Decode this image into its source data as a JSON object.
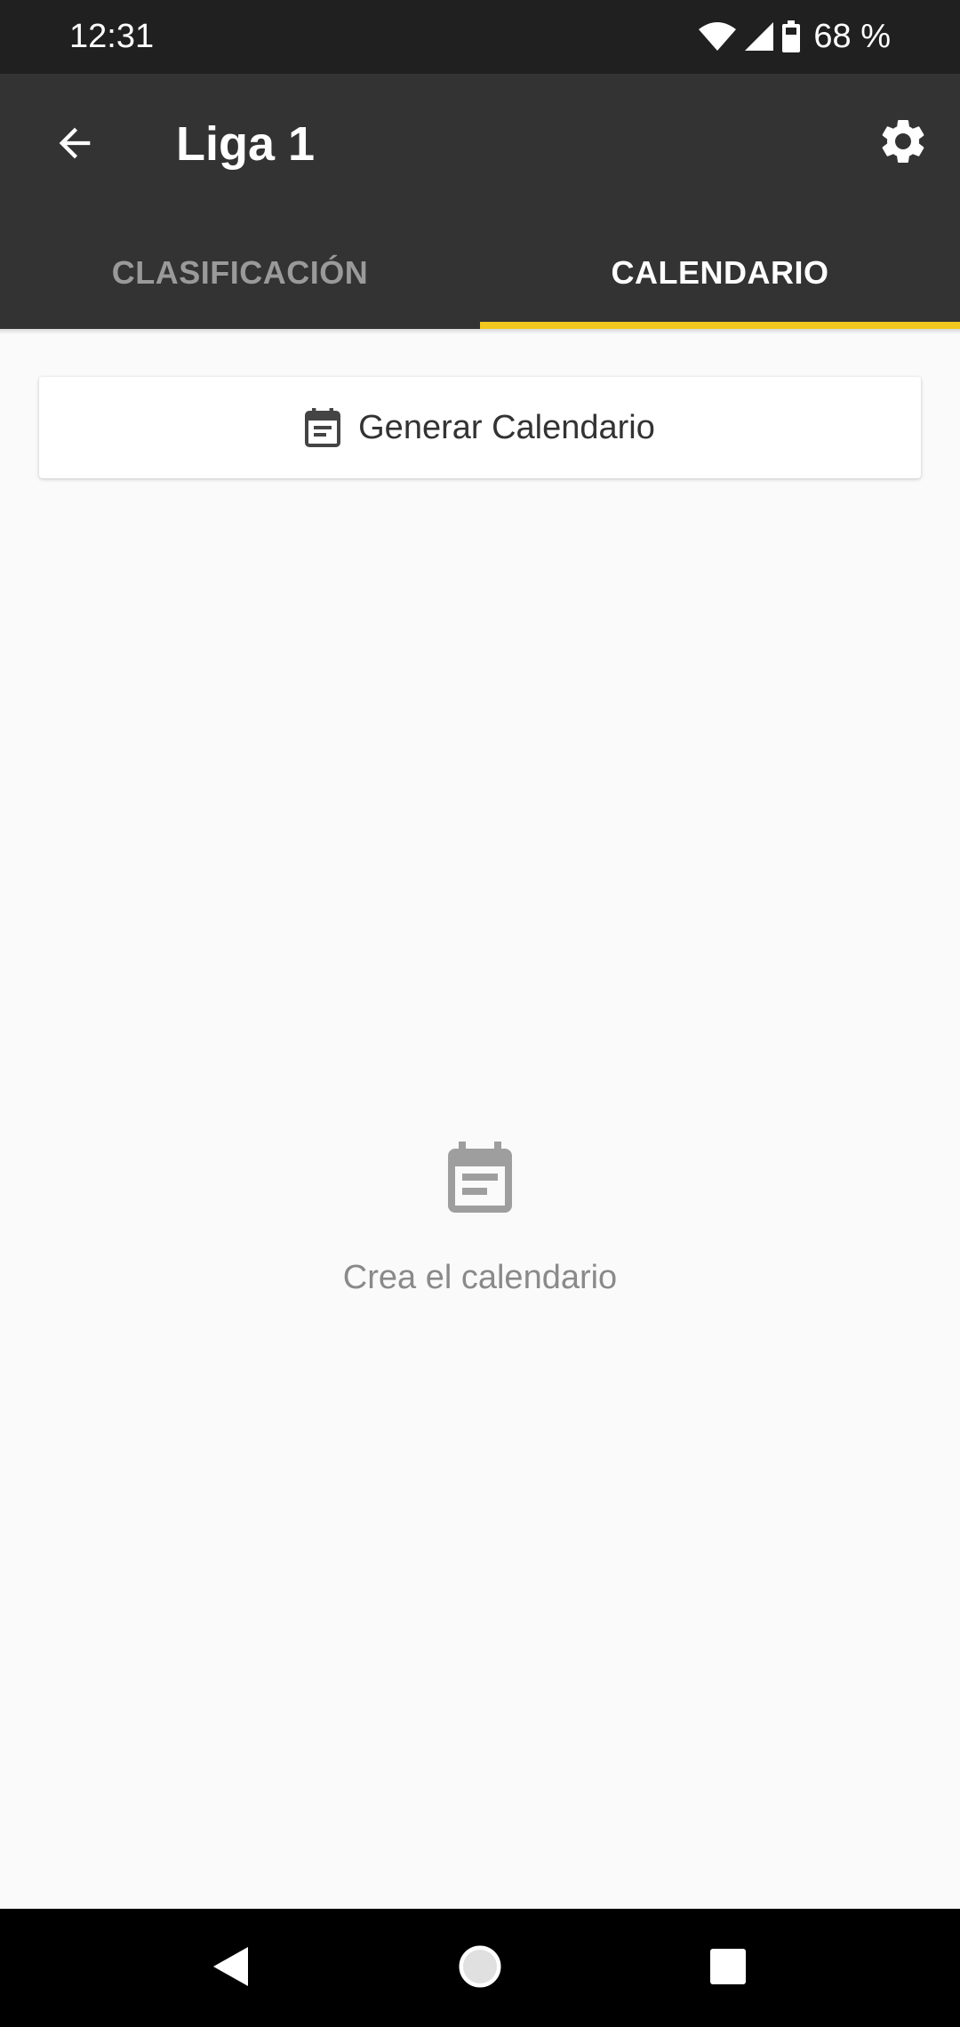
{
  "status_bar": {
    "time": "12:31",
    "battery": "68 %",
    "icons": [
      "wifi-icon",
      "signal-icon",
      "battery-icon"
    ]
  },
  "app_bar": {
    "title": "Liga 1",
    "back_icon": "arrow-back-icon",
    "settings_icon": "gear-icon"
  },
  "tabs": [
    {
      "label": "CLASIFICACIÓN",
      "active": false
    },
    {
      "label": "CALENDARIO",
      "active": true
    }
  ],
  "generate_button": {
    "label": "Generar Calendario",
    "icon": "calendar-icon"
  },
  "empty_state": {
    "icon": "calendar-icon",
    "message": "Crea el calendario"
  },
  "navigation": {
    "icons": [
      "nav-back-icon",
      "nav-home-icon",
      "nav-recents-icon"
    ]
  },
  "colors": {
    "status_bar": "#202020",
    "app_bar": "#333333",
    "accent": "#f2c81e",
    "background": "#fafafa"
  }
}
